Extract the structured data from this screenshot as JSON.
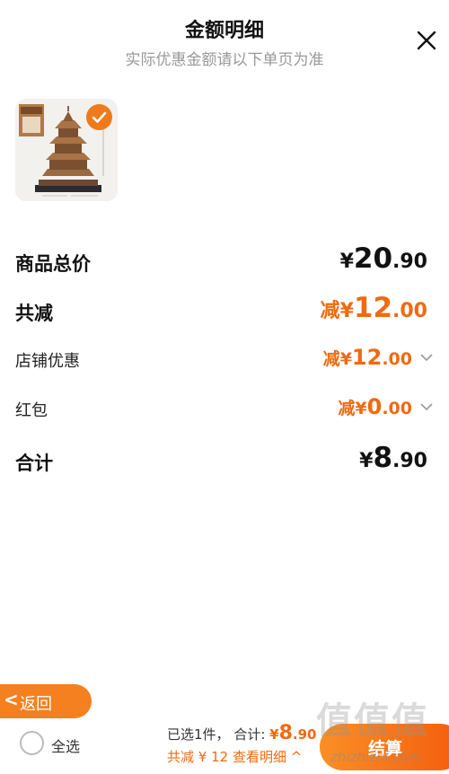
{
  "header": {
    "title": "金额明细",
    "subtitle": "实际优惠金额请以下单页为准"
  },
  "product": {
    "image_icon": "tower-building-set-image",
    "selected": true
  },
  "rows": {
    "total_price": {
      "label": "商品总价",
      "yen": "¥",
      "int": "20",
      "dec": ".90"
    },
    "total_discount": {
      "label": "共减",
      "minus": "减",
      "yen": "¥",
      "int": "12",
      "dec": ".00"
    },
    "shop_discount": {
      "label": "店铺优惠",
      "minus": "减",
      "yen": "¥",
      "int": "12",
      "dec": ".00"
    },
    "red_packet": {
      "label": "红包",
      "minus": "减",
      "yen": "¥",
      "int": "0",
      "dec": ".00"
    },
    "sum": {
      "label": "合计",
      "yen": "¥",
      "int": "8",
      "dec": ".90"
    }
  },
  "footer": {
    "back_arrow": "<",
    "back_label": "返回",
    "select_all_label": "全选",
    "selected_count": "已选1件，",
    "total_label": "合计:",
    "total_yen": "¥",
    "total_int": "8",
    "total_dec": ".90",
    "discount_text": "共减 ¥ 12",
    "detail_label": "查看明细",
    "detail_chevron": "^",
    "checkout_label": "结算"
  },
  "watermark": {
    "text": "值值值",
    "url": "zhizhizhi.com"
  },
  "colors": {
    "accent": "#f06a10",
    "button": "#f5801f",
    "muted": "#999999"
  }
}
